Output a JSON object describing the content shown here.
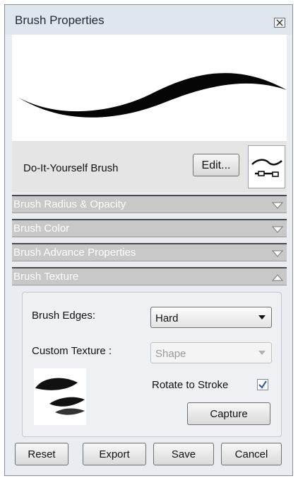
{
  "window": {
    "title": "Brush Properties",
    "close_icon": "close-icon"
  },
  "brush": {
    "name": "Do-It-Yourself Brush",
    "edit_label": "Edit...",
    "selector_icon": "brush-stroke-icon"
  },
  "sections": [
    {
      "label": "Brush Radius & Opacity",
      "state": "collapsed"
    },
    {
      "label": "Brush Color",
      "state": "collapsed"
    },
    {
      "label": "Brush Advance Properties",
      "state": "collapsed"
    },
    {
      "label": "Brush Texture",
      "state": "expanded"
    }
  ],
  "texture": {
    "edges_label": "Brush Edges:",
    "edges_value": "Hard",
    "custom_label": "Custom Texture :",
    "custom_value": "Shape",
    "rotate_label": "Rotate to Stroke",
    "rotate_checked": true,
    "capture_label": "Capture"
  },
  "footer": {
    "reset": "Reset",
    "export": "Export",
    "save": "Save",
    "cancel": "Cancel"
  },
  "colors": {
    "section_bar": "#c8c8c8",
    "checkbox_check": "#3a5fa8"
  }
}
